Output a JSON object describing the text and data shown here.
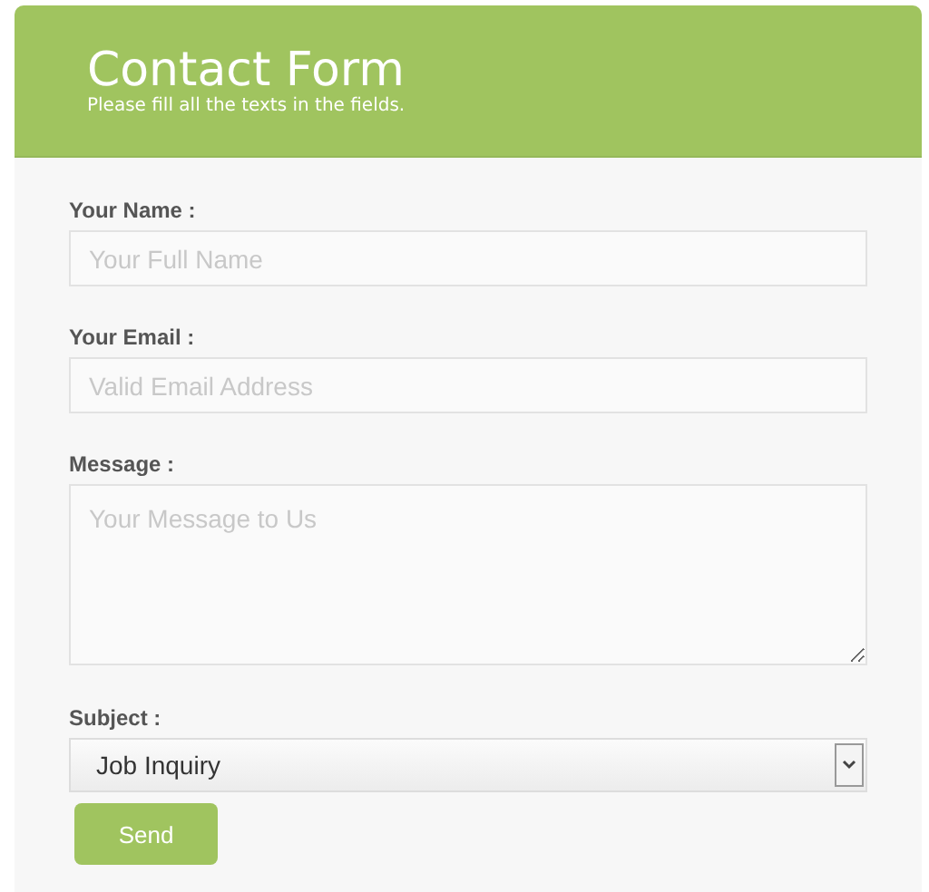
{
  "header": {
    "title": "Contact Form",
    "subtitle": "Please fill all the texts in the fields."
  },
  "fields": [
    {
      "kind": "input",
      "label": "Your Name :",
      "placeholder": "Your Full Name"
    },
    {
      "kind": "input",
      "label": "Your Email :",
      "placeholder": "Valid Email Address"
    },
    {
      "kind": "textarea",
      "label": "Message :",
      "placeholder": "Your Message to Us"
    },
    {
      "kind": "select",
      "label": "Subject :",
      "value": "Job Inquiry"
    }
  ],
  "submit": "Send"
}
